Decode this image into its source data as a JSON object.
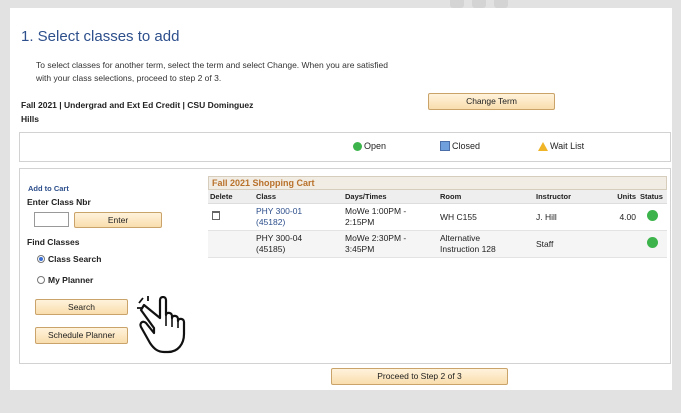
{
  "header": {
    "title": "1.  Select classes to add",
    "intro_line1": "To select classes for another term, select the term and select Change.  When you are satisfied",
    "intro_line2": "with your class selections, proceed to step 2 of 3.",
    "term_line1": "Fall 2021 | Undergrad and Ext Ed Credit | CSU Dominguez",
    "term_line2": "Hills",
    "change_term_label": "Change Term"
  },
  "legend": {
    "open": "Open",
    "closed": "Closed",
    "waitlist": "Wait List",
    "colors": {
      "open": "#3cb44b",
      "closed": "#6f9fdc",
      "waitlist": "#f0b429"
    }
  },
  "left": {
    "add_to_cart": "Add to Cart",
    "enter_class_nbr": "Enter Class Nbr",
    "class_nbr_value": "",
    "enter_label": "Enter",
    "find_classes": "Find Classes",
    "option_class_search": "Class Search",
    "option_my_planner": "My Planner",
    "selected_option": "Class Search",
    "search_label": "Search",
    "schedule_planner_label": "Schedule Planner"
  },
  "cart": {
    "title": "Fall 2021 Shopping Cart",
    "headers": [
      "Delete",
      "Class",
      "Days/Times",
      "Room",
      "Instructor",
      "Units",
      "Status"
    ],
    "rows": [
      {
        "class_line1": "PHY 300-01",
        "class_line2": "(45182)",
        "days_line1": "MoWe 1:00PM -",
        "days_line2": "2:15PM",
        "room_line1": "WH C155",
        "room_line2": "",
        "instructor": "J. Hill",
        "units": "4.00",
        "status": "Open"
      },
      {
        "class_line1": "PHY 300-04",
        "class_line2": "(45185)",
        "days_line1": "MoWe 2:30PM -",
        "days_line2": "3:45PM",
        "room_line1": "Alternative",
        "room_line2": "Instruction 128",
        "instructor": "Staff",
        "units": "",
        "status": "Open"
      }
    ]
  },
  "footer": {
    "proceed_label": "Proceed to Step 2 of 3"
  },
  "icons": {
    "delete": "trash-icon",
    "status": "open-status-icon",
    "cursor": "hand-pointer-icon"
  }
}
